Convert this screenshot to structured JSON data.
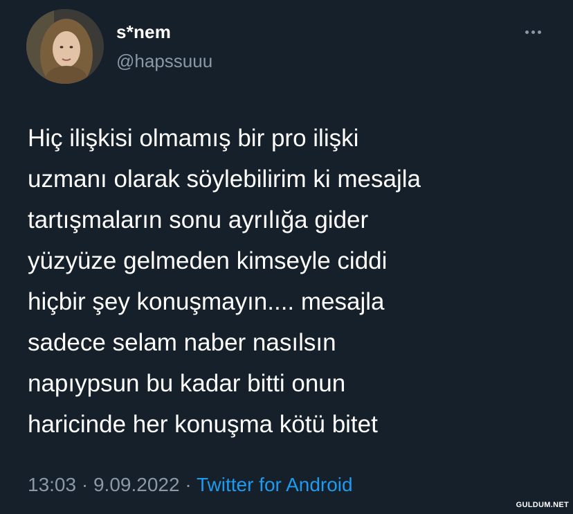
{
  "user": {
    "name": "s*nem",
    "handle": "@hapssuuu",
    "avatar_icon": "profile-photo"
  },
  "tweet": {
    "lines": [
      "Hiç ilişkisi olmamış bir pro ilişki",
      "uzmanı olarak söylebilirim ki mesajla",
      "tartışmaların sonu ayrılığa gider",
      "yüzyüze gelmeden kimseyle ciddi",
      "hiçbir şey konuşmayın.... mesajla",
      "sadece selam naber nasılsın",
      "napıypsun bu kadar bitti onun",
      "haricinde her konuşma kötü bitet"
    ]
  },
  "meta": {
    "time": "13:03",
    "separator1": " · ",
    "date": "9.09.2022",
    "separator2": " · ",
    "source": "Twitter for Android"
  },
  "more_icon": "more-horizontal-icon",
  "watermark": "GULDUM.NET",
  "colors": {
    "background": "#15202b",
    "primary_text": "#ffffff",
    "secondary_text": "#8b98a5",
    "link": "#1d9bf0"
  }
}
